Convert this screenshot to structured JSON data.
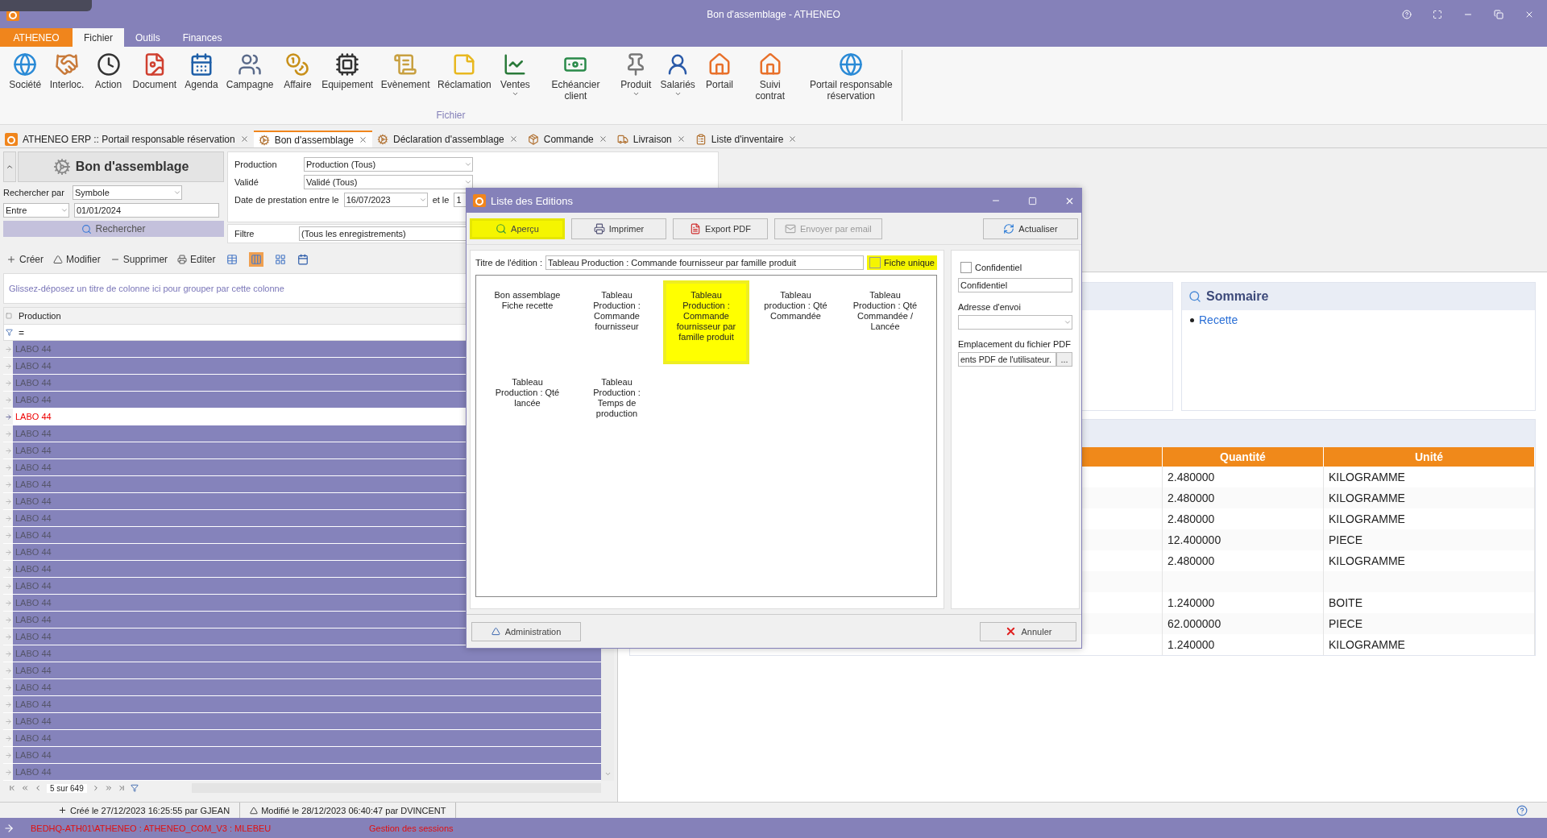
{
  "window": {
    "title": "Bon d'assemblage - ATHENEO"
  },
  "ribbon": {
    "app_tab": "ATHENEO",
    "group": "Fichier",
    "tabs": [
      {
        "label": "Fichier",
        "selected": true
      },
      {
        "label": "Outils",
        "selected": false
      },
      {
        "label": "Finances",
        "selected": false
      }
    ],
    "items": [
      {
        "label": "Société",
        "dropdown": false
      },
      {
        "label": "Interloc.",
        "dropdown": false
      },
      {
        "label": "Action",
        "dropdown": false
      },
      {
        "label": "Document",
        "dropdown": false
      },
      {
        "label": "Agenda",
        "dropdown": false
      },
      {
        "label": "Campagne",
        "dropdown": false
      },
      {
        "label": "Affaire",
        "dropdown": false
      },
      {
        "label": "Equipement",
        "dropdown": false
      },
      {
        "label": "Evènement",
        "dropdown": false
      },
      {
        "label": "Réclamation",
        "dropdown": false
      },
      {
        "label": "Ventes",
        "dropdown": true
      },
      {
        "label": "Echéancier client",
        "dropdown": false
      },
      {
        "label": "Produit",
        "dropdown": true
      },
      {
        "label": "Salariés",
        "dropdown": true
      },
      {
        "label": "Portail",
        "dropdown": false
      },
      {
        "label": "Suivi contrat",
        "dropdown": false
      },
      {
        "label": "Portail responsable réservation",
        "dropdown": false
      }
    ]
  },
  "doc_tabs": [
    {
      "label": "ATHENEO ERP :: Portail responsable réservation",
      "selected": false
    },
    {
      "label": "Bon d'assemblage",
      "selected": true
    },
    {
      "label": "Déclaration d'assemblage",
      "selected": false
    },
    {
      "label": "Commande",
      "selected": false
    },
    {
      "label": "Livraison",
      "selected": false
    },
    {
      "label": "Liste d'inventaire",
      "selected": false
    }
  ],
  "search_panel": {
    "title": "Bon d'assemblage",
    "search_by_label": "Rechercher par",
    "search_by": "Symbole",
    "operator": "Entre",
    "date": "01/01/2024",
    "button": "Rechercher"
  },
  "filters": {
    "production_label": "Production",
    "production": "Production (Tous)",
    "valide_label": "Validé",
    "valide": "Validé (Tous)",
    "date_label": "Date de prestation entre le",
    "date_from": "16/07/2023",
    "and_label": "et le",
    "date_to": "1",
    "filter_label": "Filtre",
    "filter": "(Tous les enregistrements)"
  },
  "toolbar": {
    "actions": [
      "Créer",
      "Modifier",
      "Supprimer",
      "Editer"
    ],
    "views": [
      {
        "selected": false
      },
      {
        "selected": true
      },
      {
        "selected": false
      }
    ]
  },
  "grid": {
    "group_hint": "Glissez-déposez un titre de colonne ici pour grouper par cette colonne",
    "column": "Production",
    "filter_value": "=",
    "pager": "5 sur 649",
    "rows": [
      {
        "label": "LABO 44",
        "selected": false
      },
      {
        "label": "LABO 44",
        "selected": false
      },
      {
        "label": "LABO 44",
        "selected": false
      },
      {
        "label": "LABO 44",
        "selected": false
      },
      {
        "label": "LABO 44",
        "selected": true
      },
      {
        "label": "LABO 44",
        "selected": false
      },
      {
        "label": "LABO 44",
        "selected": false
      },
      {
        "label": "LABO 44",
        "selected": false
      },
      {
        "label": "LABO 44",
        "selected": false
      },
      {
        "label": "LABO 44",
        "selected": false
      },
      {
        "label": "LABO 44",
        "selected": false
      },
      {
        "label": "LABO 44",
        "selected": false
      },
      {
        "label": "LABO 44",
        "selected": false
      },
      {
        "label": "LABO 44",
        "selected": false
      },
      {
        "label": "LABO 44",
        "selected": false
      },
      {
        "label": "LABO 44",
        "selected": false
      },
      {
        "label": "LABO 44",
        "selected": false
      },
      {
        "label": "LABO 44",
        "selected": false
      },
      {
        "label": "LABO 44",
        "selected": false
      },
      {
        "label": "LABO 44",
        "selected": false
      },
      {
        "label": "LABO 44",
        "selected": false
      },
      {
        "label": "LABO 44",
        "selected": false
      },
      {
        "label": "LABO 44",
        "selected": false
      },
      {
        "label": "LABO 44",
        "selected": false
      },
      {
        "label": "LABO 44",
        "selected": false
      },
      {
        "label": "LABO 44",
        "selected": false
      }
    ]
  },
  "report": {
    "summary_title": "Sommaire",
    "summary_links": [
      "Recette"
    ],
    "columns": [
      "Quantité",
      "Unité"
    ],
    "rows": [
      {
        "quantity": "2.480000",
        "unit": "KILOGRAMME"
      },
      {
        "quantity": "2.480000",
        "unit": "KILOGRAMME"
      },
      {
        "quantity": "2.480000",
        "unit": "KILOGRAMME"
      },
      {
        "quantity": "12.400000",
        "unit": "PIECE"
      },
      {
        "quantity": "2.480000",
        "unit": "KILOGRAMME"
      },
      {},
      {
        "quantity": "1.240000",
        "unit": "BOITE"
      },
      {
        "quantity": "62.000000",
        "unit": "PIECE"
      },
      {
        "quantity": "1.240000",
        "unit": "KILOGRAMME"
      }
    ]
  },
  "dialog": {
    "title": "Liste des Editions",
    "buttons": [
      {
        "label": "Aperçu",
        "highlighted": true,
        "disabled": false
      },
      {
        "label": "Imprimer",
        "highlighted": false,
        "disabled": false
      },
      {
        "label": "Export PDF",
        "highlighted": false,
        "disabled": false
      },
      {
        "label": "Envoyer par email",
        "highlighted": false,
        "disabled": true
      },
      {
        "label": "Actualiser",
        "highlighted": false,
        "disabled": false
      }
    ],
    "title_label": "Titre de l'édition :",
    "title_value": "Tableau Production : Commande fournisseur par famille produit",
    "single": {
      "label": "Fiche unique",
      "checked": false,
      "highlighted": true
    },
    "reports": [
      {
        "label": "Bon assemblage Fiche recette",
        "selected": false
      },
      {
        "label": "Tableau Production : Commande fournisseur",
        "selected": false
      },
      {
        "label": "Tableau Production : Commande fournisseur par famille produit",
        "selected": true
      },
      {
        "label": "Tableau production : Qté Commandée",
        "selected": false
      },
      {
        "label": "Tableau Production : Qté Commandée / Lancée",
        "selected": false
      },
      {
        "label": "Tableau Production : Qté lancée",
        "selected": false
      },
      {
        "label": "Tableau Production : Temps de production",
        "selected": false
      }
    ],
    "confidential": {
      "label": "Confidentiel",
      "checked": false
    },
    "confidential_text": "Confidentiel",
    "address_label": "Adresse d'envoi",
    "pdf_label": "Emplacement du fichier PDF",
    "pdf_path": "ents PDF de l'utilisateur.",
    "browse": "...",
    "admin": "Administration",
    "cancel": "Annuler"
  },
  "status_bar": {
    "created": "Créé le 27/12/2023 16:25:55 par GJEAN",
    "modified": "Modifié le 28/12/2023 06:40:47 par DVINCENT"
  },
  "session_bar": {
    "connection": "BEDHQ-ATH01\\ATHENEO : ATHENEO_COM_V3 : MLEBEU",
    "sessions": "Gestion des sessions"
  }
}
